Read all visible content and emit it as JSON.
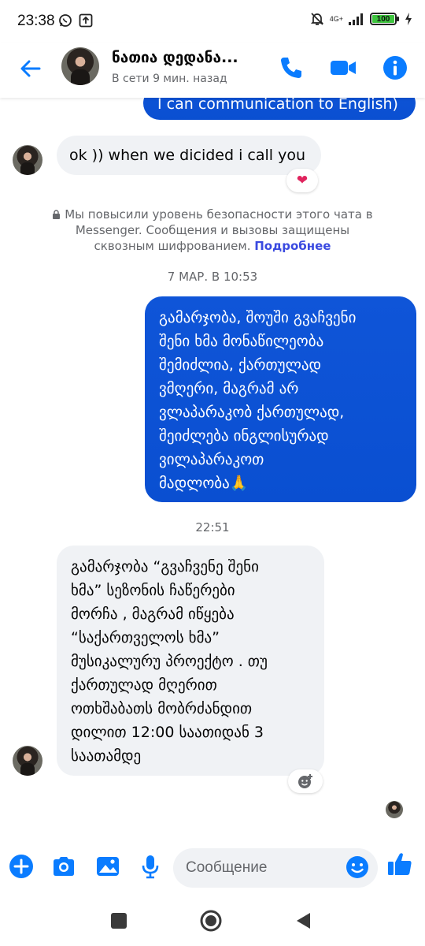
{
  "status_bar": {
    "time": "23:38",
    "network": "4G+",
    "battery": "100",
    "icons": [
      "whatsapp-icon",
      "upload-icon",
      "mute-icon",
      "signal-icon",
      "battery-icon",
      "charging-icon"
    ]
  },
  "header": {
    "name": "ნათია დედანა...",
    "status": "В сети 9 мин. назад",
    "icons": [
      "back-arrow-icon",
      "phone-icon",
      "video-icon",
      "info-icon"
    ],
    "accent": "#0a7cff"
  },
  "messages": {
    "top_partial": "I can communication to English)",
    "msg1": "ok )) when we dicided i call you",
    "msg1_reaction": "❤",
    "system_notice": "Мы повысили уровень безопасности этого чата в Messenger. Сообщения и вызовы защищены сквозным шифрованием.",
    "system_link": "Подробнее",
    "time1": "7 МАР. В 10:53",
    "msg2": "გამარჯობა, შოუში გვაჩვენი\nშენი ხმა მონაწილეობა\nშემიძლია, ქართულად\nვმღერი, მაგრამ არ\nვლაპარაკობ ქართულად,\nშეიძლება ინგლისურად\nვილაპარაკოთ\nმადლობა🙏",
    "time2": "22:51",
    "msg3": "გამარჯობა “გვაჩვენე შენი\nხმა” სეზონის ჩაწერები\nმორჩა , მაგრამ იწყება\n“საქართველოს ხმა”\nმუსიკალურუ პროექტო . თუ\nქართულად მღერით\nოთხშაბათს  მობრძანდით\nდილით 12:00 საათიდან 3\nსაათამდე"
  },
  "composer": {
    "placeholder": "Сообщение",
    "icons": [
      "plus-icon",
      "camera-icon",
      "gallery-icon",
      "mic-icon",
      "emoji-icon",
      "thumbs-up-icon"
    ]
  },
  "colors": {
    "outgoing_bubble": "#0b52d6",
    "incoming_bubble": "#f0f2f5",
    "brand": "#0a7cff"
  }
}
